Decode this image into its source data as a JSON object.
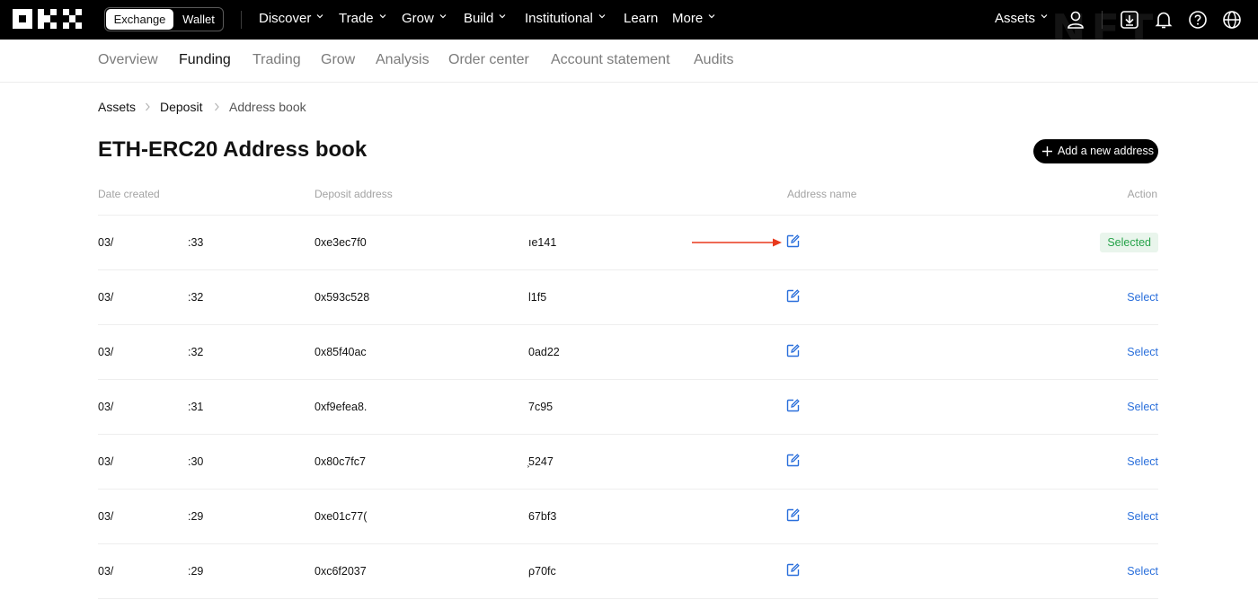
{
  "colors": {
    "nav_bg": "#000000",
    "accent_link": "#2a6fdb",
    "selected_bg": "#e9f5ec",
    "selected_text": "#27a34a",
    "annotation_arrow": "#e8391c"
  },
  "header": {
    "mode_toggle": {
      "exchange": "Exchange",
      "wallet": "Wallet"
    },
    "menu": [
      {
        "label": "Discover",
        "dropdown": true
      },
      {
        "label": "Trade",
        "dropdown": true
      },
      {
        "label": "Grow",
        "dropdown": true
      },
      {
        "label": "Build",
        "dropdown": true
      },
      {
        "label": "Institutional",
        "dropdown": true
      },
      {
        "label": "Learn",
        "dropdown": false
      },
      {
        "label": "More",
        "dropdown": true
      }
    ],
    "assets_label": "Assets",
    "icons": [
      "user-icon",
      "download-icon",
      "bell-icon",
      "help-icon",
      "globe-icon"
    ]
  },
  "subnav": {
    "items": [
      "Overview",
      "Funding",
      "Trading",
      "Grow",
      "Analysis",
      "Order center",
      "Account statement",
      "Audits"
    ],
    "active": "Funding"
  },
  "breadcrumb": [
    "Assets",
    "Deposit",
    "Address book"
  ],
  "page_title": "ETH-ERC20 Address book",
  "add_button_label": "Add a new address",
  "table": {
    "headers": {
      "date": "Date created",
      "address": "Deposit address",
      "name": "Address name",
      "action": "Action"
    },
    "rows": [
      {
        "date_start": "03/",
        "date_end": ":33",
        "addr_start": "0xe3ec7f0",
        "addr_end": "ıe141",
        "status": "Selected"
      },
      {
        "date_start": "03/",
        "date_end": ":32",
        "addr_start": "0x593c528",
        "addr_end": "l1f5",
        "status": "Select"
      },
      {
        "date_start": "03/",
        "date_end": ":32",
        "addr_start": "0x85f40ac",
        "addr_end": "0ad22",
        "status": "Select"
      },
      {
        "date_start": "03/",
        "date_end": ":31",
        "addr_start": "0xf9efea8.",
        "addr_end": "7c95",
        "status": "Select"
      },
      {
        "date_start": "03/",
        "date_end": ":30",
        "addr_start": "0x80c7fc7",
        "addr_end": "͕5247",
        "status": "Select"
      },
      {
        "date_start": "03/",
        "date_end": ":29",
        "addr_start": "0xe01c77(",
        "addr_end": "67bf3",
        "status": "Select"
      },
      {
        "date_start": "03/",
        "date_end": ":29",
        "addr_start": "0xc6f2037",
        "addr_end": "ρ70fc",
        "status": "Select"
      }
    ]
  }
}
